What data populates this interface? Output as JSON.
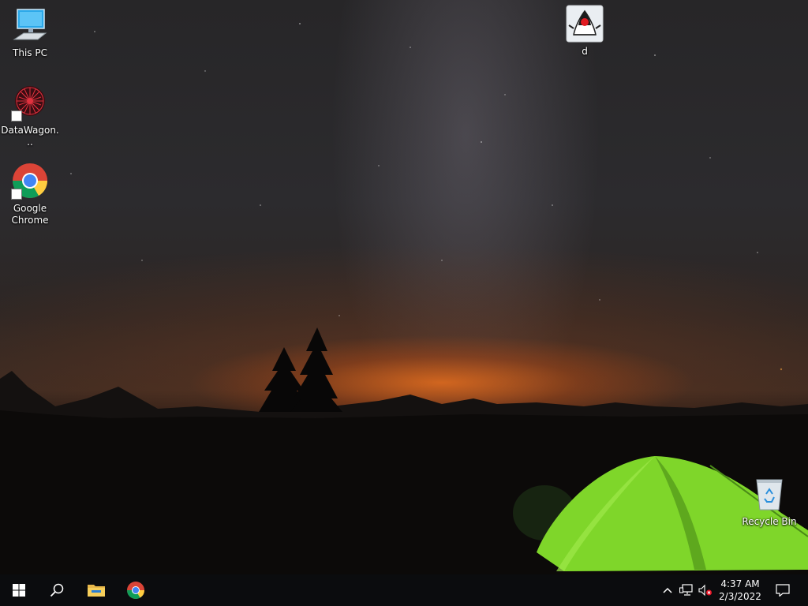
{
  "desktop": {
    "icons": [
      {
        "label": "This PC",
        "icon": "computer-icon"
      },
      {
        "label": "DataWagon...",
        "icon": "datawagon-icon"
      },
      {
        "label": "Google Chrome",
        "icon": "chrome-icon"
      },
      {
        "label": "d",
        "icon": "java-icon"
      },
      {
        "label": "Recycle Bin",
        "icon": "recycle-bin-icon"
      }
    ]
  },
  "taskbar": {
    "start": {
      "icon": "windows-start-icon"
    },
    "search": {
      "icon": "search-icon"
    },
    "pinned": [
      {
        "name": "File Explorer",
        "icon": "folder-icon"
      },
      {
        "name": "Google Chrome",
        "icon": "chrome-icon"
      }
    ],
    "tray": {
      "icons": [
        "chevron-up-icon",
        "network-icon",
        "volume-muted-icon",
        "notification-icon"
      ],
      "time": "4:37 AM",
      "date": "2/3/2022"
    }
  }
}
